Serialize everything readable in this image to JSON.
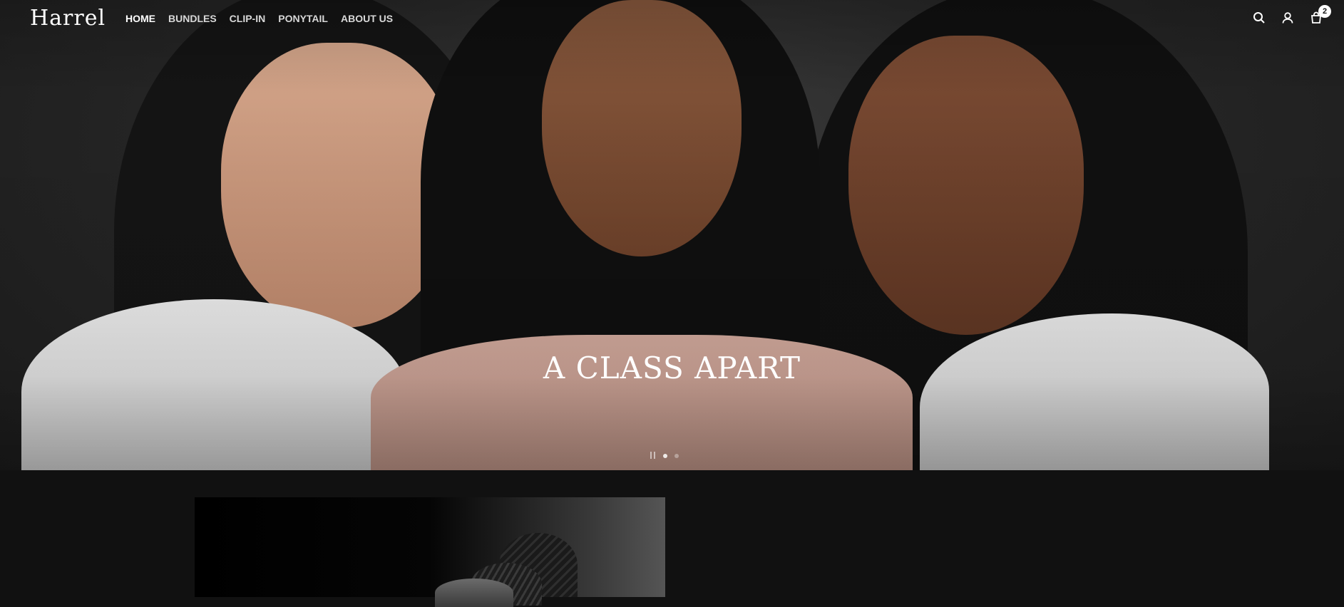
{
  "brand": {
    "logo_text": "Harrel"
  },
  "nav": {
    "items": [
      {
        "label": "HOME",
        "active": true
      },
      {
        "label": "BUNDLES",
        "active": false
      },
      {
        "label": "CLIP-IN",
        "active": false
      },
      {
        "label": "PONYTAIL",
        "active": false
      },
      {
        "label": "ABOUT US",
        "active": false
      }
    ]
  },
  "header_icons": {
    "search": "search-icon",
    "account": "account-icon",
    "cart": "cart-icon",
    "cart_count": "2"
  },
  "hero": {
    "title": "A CLASS APART",
    "slides_total": 2,
    "active_slide": 1
  },
  "colors": {
    "background": "#111111",
    "text": "#ffffff"
  }
}
